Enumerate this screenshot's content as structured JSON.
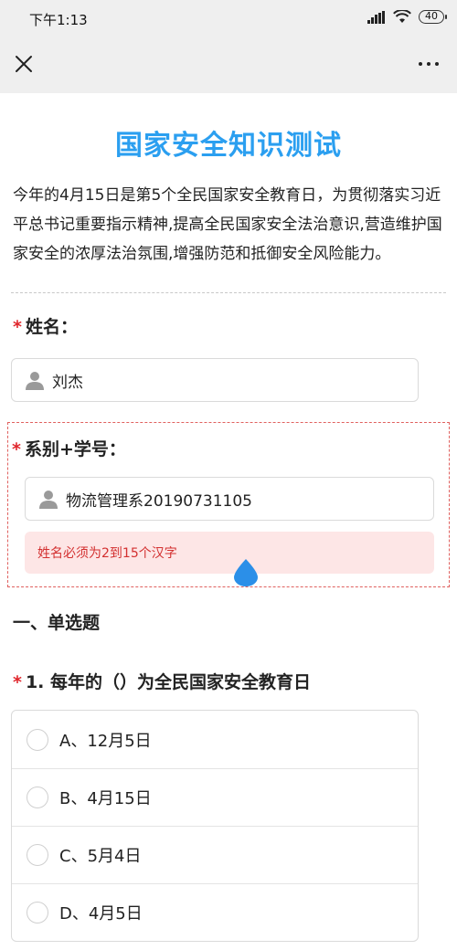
{
  "status_bar": {
    "time": "下午1:13",
    "battery": "40"
  },
  "page": {
    "title": "国家安全知识测试",
    "intro": "今年的4月15日是第5个全民国家安全教育日，为贯彻落实习近平总书记重要指示精神,提高全民国家安全法治意识,营造维护国家安全的浓厚法治氛围,增强防范和抵御安全风险能力。"
  },
  "questions": {
    "name": {
      "required_mark": "*",
      "label": "姓名：",
      "value": "刘杰"
    },
    "dept": {
      "required_mark": "*",
      "label": "系别+学号：",
      "value": "物流管理系20190731105",
      "error": "姓名必须为2到15个汉字"
    }
  },
  "section": {
    "title": "一、单选题"
  },
  "single": {
    "q1": {
      "required_mark": "*",
      "label": "1. 每年的（）为全民国家安全教育日",
      "options": [
        "A、12月5日",
        "B、4月15日",
        "C、5月4日",
        "D、4月5日"
      ]
    }
  },
  "colors": {
    "title": "#2b9ff0",
    "required": "#e0262c",
    "error_bg": "#fde6e6",
    "error_text": "#d33030",
    "cursor": "#2b8fe8"
  },
  "icons": {
    "close": "close-icon",
    "more": "more-icon",
    "user": "user-icon",
    "signal": "signal-icon",
    "wifi": "wifi-icon",
    "battery": "battery-icon"
  }
}
